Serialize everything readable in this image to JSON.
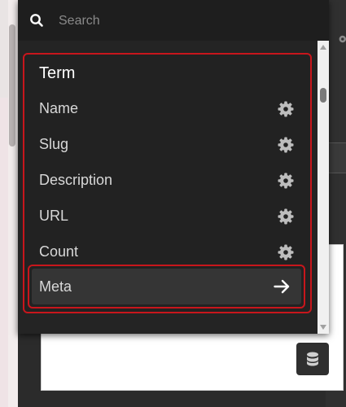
{
  "search": {
    "placeholder": "Search",
    "value": ""
  },
  "group": {
    "title": "Term",
    "items": [
      {
        "label": "Name",
        "icon": "gear-icon"
      },
      {
        "label": "Slug",
        "icon": "gear-icon"
      },
      {
        "label": "Description",
        "icon": "gear-icon"
      },
      {
        "label": "URL",
        "icon": "gear-icon"
      },
      {
        "label": "Count",
        "icon": "gear-icon"
      }
    ],
    "meta": {
      "label": "Meta",
      "icon": "arrow-right-icon"
    }
  },
  "colors": {
    "highlight_border": "#c8161c",
    "dropdown_bg": "#242424",
    "text": "#d8d8d8"
  }
}
